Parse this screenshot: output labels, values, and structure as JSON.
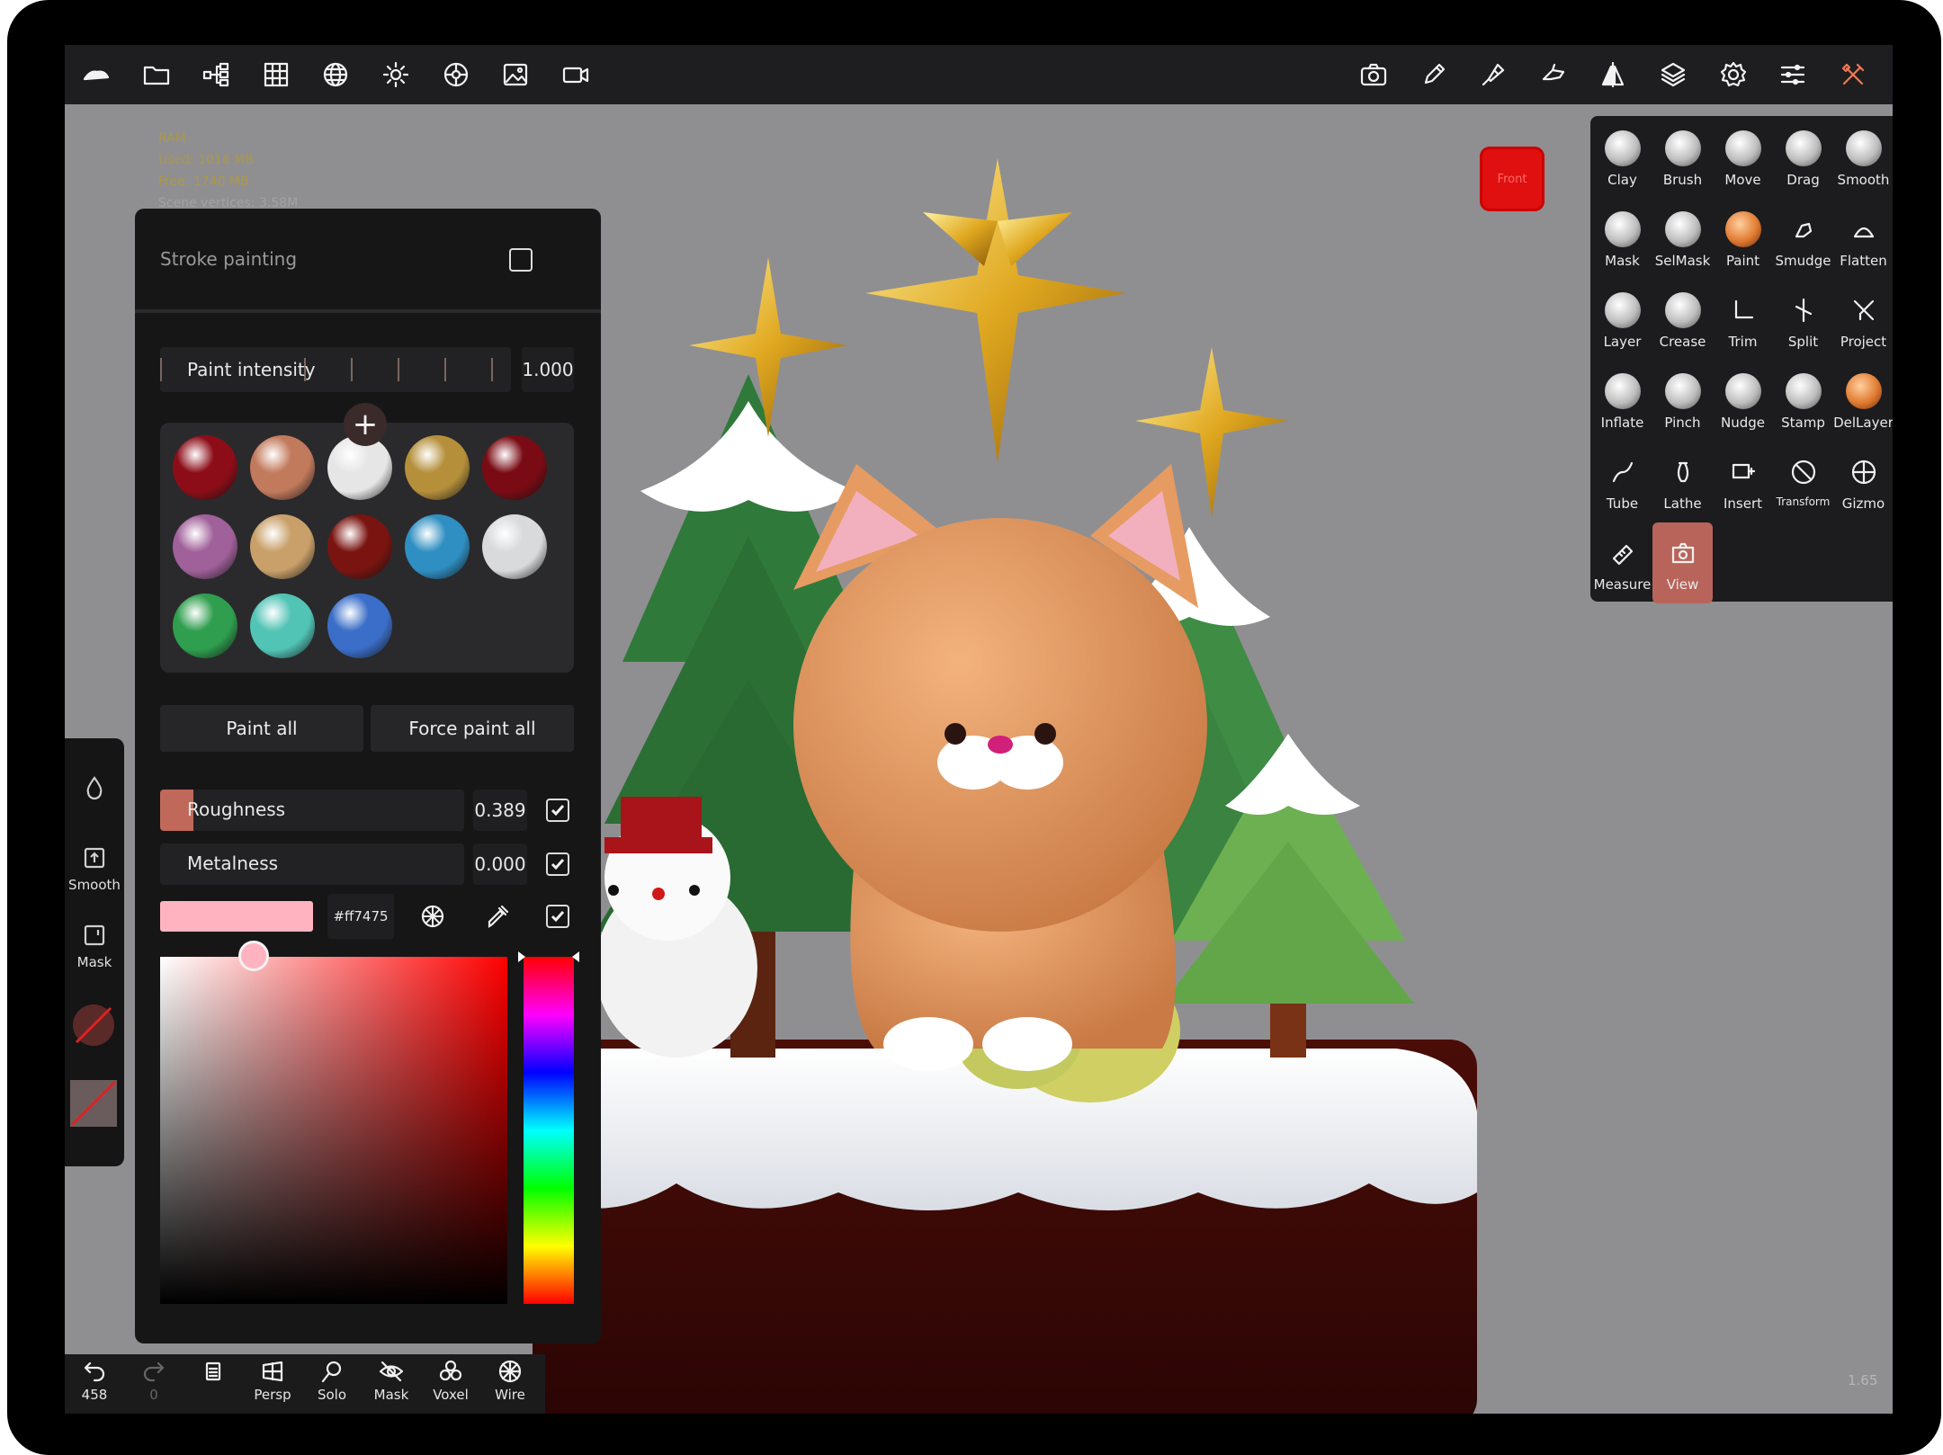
{
  "stats": {
    "line1": "RAM",
    "line2": "Used: 1016 MB",
    "line3": "Free: 1740 MB",
    "line4": "Scene vertices: 3.58M"
  },
  "panel": {
    "title": "Stroke painting",
    "paint_intensity_label": "Paint intensity",
    "paint_intensity_value": "1.000",
    "paint_all": "Paint all",
    "force_paint_all": "Force paint all",
    "roughness_label": "Roughness",
    "roughness_value": "0.389",
    "roughness_fraction": 0.389,
    "metalness_label": "Metalness",
    "metalness_value": "0.000",
    "color_hex": "#ff7475",
    "color_swatch": "#ffb3c0",
    "materials": [
      {
        "color": "#8c0d18"
      },
      {
        "color": "#c27a5c"
      },
      {
        "color": "#e6e6e6"
      },
      {
        "color": "#b58f3a"
      },
      {
        "color": "#7a0b14"
      },
      {
        "color": "#a0609a"
      },
      {
        "color": "#c9a06a"
      },
      {
        "color": "#7a1410"
      },
      {
        "color": "#2f8fc2"
      },
      {
        "color": "#d8dadc"
      },
      {
        "color": "#2f9e4e"
      },
      {
        "color": "#52c4b6"
      },
      {
        "color": "#3a6ec8"
      }
    ]
  },
  "tools": [
    {
      "label": "Clay"
    },
    {
      "label": "Brush"
    },
    {
      "label": "Move"
    },
    {
      "label": "Drag"
    },
    {
      "label": "Smooth"
    },
    {
      "label": "Mask"
    },
    {
      "label": "SelMask"
    },
    {
      "label": "Paint"
    },
    {
      "label": "Smudge"
    },
    {
      "label": "Flatten"
    },
    {
      "label": "Layer"
    },
    {
      "label": "Crease"
    },
    {
      "label": "Trim"
    },
    {
      "label": "Split"
    },
    {
      "label": "Project"
    },
    {
      "label": "Inflate"
    },
    {
      "label": "Pinch"
    },
    {
      "label": "Nudge"
    },
    {
      "label": "Stamp"
    },
    {
      "label": "DelLayer"
    },
    {
      "label": "Tube"
    },
    {
      "label": "Lathe"
    },
    {
      "label": "Insert"
    },
    {
      "label": "Transform"
    },
    {
      "label": "Gizmo"
    },
    {
      "label": "Measure"
    },
    {
      "label": "View"
    }
  ],
  "minibar": {
    "smooth": "Smooth",
    "mask": "Mask"
  },
  "bottombar": {
    "undo_count": "458",
    "redo_count": "0",
    "persp": "Persp",
    "solo": "Solo",
    "mask": "Mask",
    "voxel": "Voxel",
    "wire": "Wire"
  },
  "front_label": "Front",
  "zoom": "1.65"
}
